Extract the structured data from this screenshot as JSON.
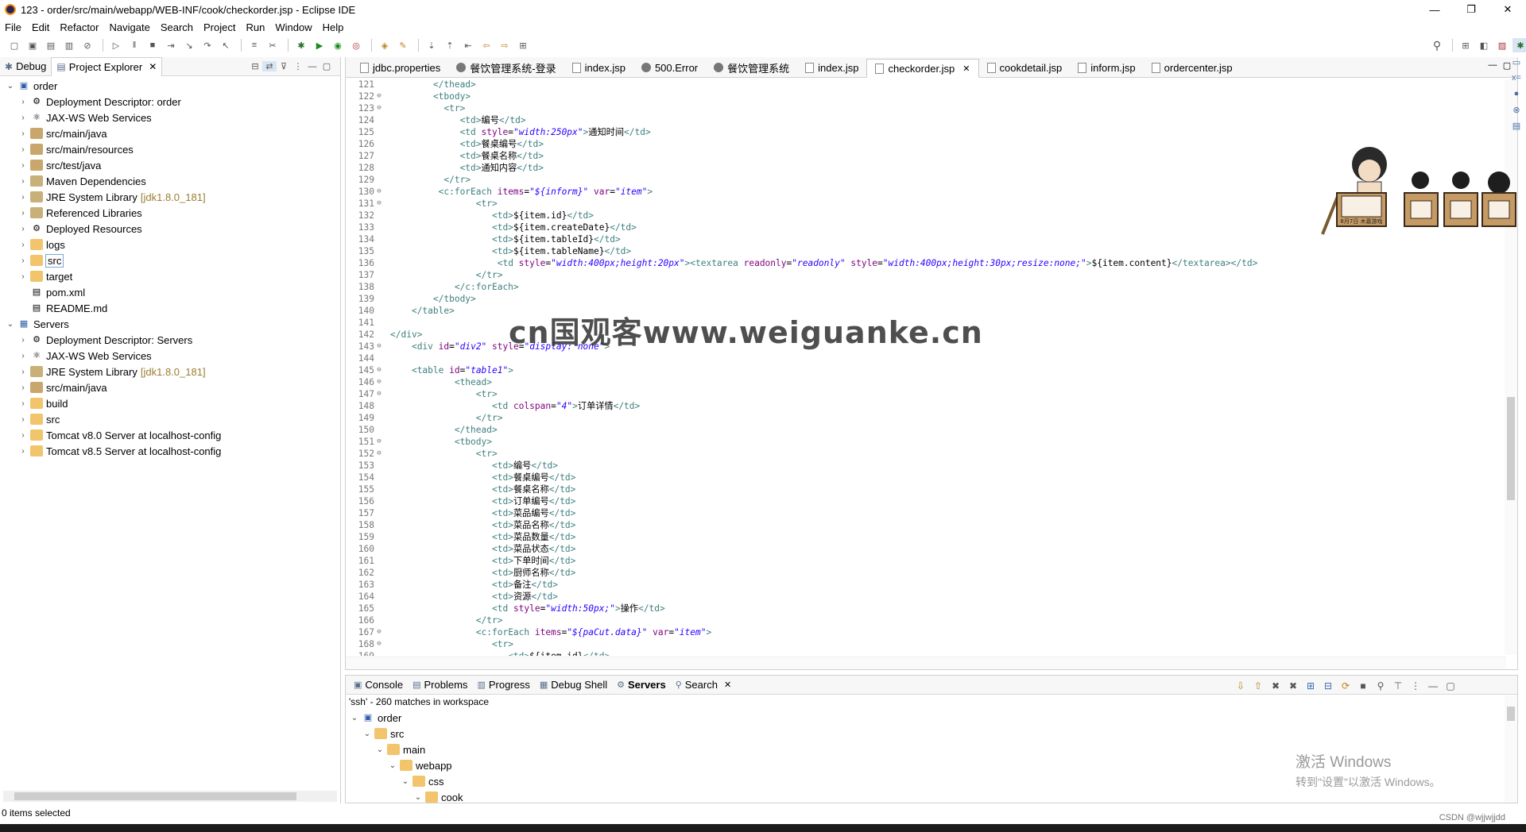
{
  "window": {
    "title": "123 - order/src/main/webapp/WEB-INF/cook/checkorder.jsp - Eclipse IDE",
    "controls": [
      "—",
      "❐",
      "✕"
    ]
  },
  "menu": [
    "File",
    "Edit",
    "Refactor",
    "Navigate",
    "Search",
    "Project",
    "Run",
    "Window",
    "Help"
  ],
  "left_panel": {
    "tabs": [
      {
        "label": "Debug",
        "active": false
      },
      {
        "label": "Project Explorer",
        "active": true
      }
    ],
    "tree": [
      {
        "depth": 0,
        "arrow": "v",
        "icon": "project",
        "label": "order"
      },
      {
        "depth": 1,
        "arrow": ">",
        "icon": "descriptor",
        "label": "Deployment Descriptor: order"
      },
      {
        "depth": 1,
        "arrow": ">",
        "icon": "ws",
        "label": "JAX-WS Web Services"
      },
      {
        "depth": 1,
        "arrow": ">",
        "icon": "pkg",
        "label": "src/main/java"
      },
      {
        "depth": 1,
        "arrow": ">",
        "icon": "pkg",
        "label": "src/main/resources"
      },
      {
        "depth": 1,
        "arrow": ">",
        "icon": "pkg",
        "label": "src/test/java"
      },
      {
        "depth": 1,
        "arrow": ">",
        "icon": "lib",
        "label": "Maven Dependencies"
      },
      {
        "depth": 1,
        "arrow": ">",
        "icon": "lib",
        "label": "JRE System Library",
        "suffix": "[jdk1.8.0_181]"
      },
      {
        "depth": 1,
        "arrow": ">",
        "icon": "lib",
        "label": "Referenced Libraries"
      },
      {
        "depth": 1,
        "arrow": ">",
        "icon": "descriptor",
        "label": "Deployed Resources"
      },
      {
        "depth": 1,
        "arrow": ">",
        "icon": "folder",
        "label": "logs"
      },
      {
        "depth": 1,
        "arrow": ">",
        "icon": "folder",
        "label": "src",
        "selected": true
      },
      {
        "depth": 1,
        "arrow": ">",
        "icon": "folder",
        "label": "target"
      },
      {
        "depth": 1,
        "arrow": "",
        "icon": "file",
        "label": "pom.xml"
      },
      {
        "depth": 1,
        "arrow": "",
        "icon": "file",
        "label": "README.md"
      },
      {
        "depth": 0,
        "arrow": "v",
        "icon": "servers",
        "label": "Servers"
      },
      {
        "depth": 1,
        "arrow": ">",
        "icon": "descriptor",
        "label": "Deployment Descriptor: Servers"
      },
      {
        "depth": 1,
        "arrow": ">",
        "icon": "ws",
        "label": "JAX-WS Web Services"
      },
      {
        "depth": 1,
        "arrow": ">",
        "icon": "lib",
        "label": "JRE System Library",
        "suffix": "[jdk1.8.0_181]"
      },
      {
        "depth": 1,
        "arrow": ">",
        "icon": "pkg",
        "label": "src/main/java"
      },
      {
        "depth": 1,
        "arrow": ">",
        "icon": "folder",
        "label": "build"
      },
      {
        "depth": 1,
        "arrow": ">",
        "icon": "folder",
        "label": "src"
      },
      {
        "depth": 1,
        "arrow": ">",
        "icon": "folder",
        "label": "Tomcat v8.0 Server at localhost-config"
      },
      {
        "depth": 1,
        "arrow": ">",
        "icon": "folder",
        "label": "Tomcat v8.5 Server at localhost-config"
      }
    ]
  },
  "editor": {
    "tabs": [
      {
        "label": "jdbc.properties",
        "icon": "file"
      },
      {
        "label": "餐饮管理系统-登录",
        "icon": "globe"
      },
      {
        "label": "index.jsp",
        "icon": "file"
      },
      {
        "label": "500.Error",
        "icon": "globe"
      },
      {
        "label": "餐饮管理系统",
        "icon": "globe"
      },
      {
        "label": "index.jsp",
        "icon": "file"
      },
      {
        "label": "checkorder.jsp",
        "icon": "file",
        "active": true
      },
      {
        "label": "cookdetail.jsp",
        "icon": "file"
      },
      {
        "label": "inform.jsp",
        "icon": "file"
      },
      {
        "label": "ordercenter.jsp",
        "icon": "file"
      }
    ],
    "lines": [
      {
        "n": "121",
        "fold": "",
        "code": "        </thead>"
      },
      {
        "n": "122",
        "fold": "⊖",
        "code": "        <tbody>"
      },
      {
        "n": "123",
        "fold": "⊖",
        "code": "          <tr>"
      },
      {
        "n": "124",
        "fold": "",
        "code": "             <td>编号</td>"
      },
      {
        "n": "125",
        "fold": "",
        "code": "             <td style=\"width:250px\">通知时间</td>"
      },
      {
        "n": "126",
        "fold": "",
        "code": "             <td>餐桌编号</td>"
      },
      {
        "n": "127",
        "fold": "",
        "code": "             <td>餐桌名称</td>"
      },
      {
        "n": "128",
        "fold": "",
        "code": "             <td>通知内容</td>"
      },
      {
        "n": "129",
        "fold": "",
        "code": "          </tr>"
      },
      {
        "n": "130",
        "fold": "⊖",
        "code": "         <c:forEach items=\"${inform}\" var=\"item\">"
      },
      {
        "n": "131",
        "fold": "⊖",
        "code": "                <tr>"
      },
      {
        "n": "132",
        "fold": "",
        "code": "                   <td>${item.id}</td>"
      },
      {
        "n": "133",
        "fold": "",
        "code": "                   <td>${item.createDate}</td>"
      },
      {
        "n": "134",
        "fold": "",
        "code": "                   <td>${item.tableId}</td>"
      },
      {
        "n": "135",
        "fold": "",
        "code": "                   <td>${item.tableName}</td>"
      },
      {
        "n": "136",
        "fold": "",
        "code": "                    <td style=\"width:400px;height:20px\"><textarea readonly=\"readonly\" style=\"width:400px;height:30px;resize:none;\">${item.content}</textarea></td>"
      },
      {
        "n": "137",
        "fold": "",
        "code": "                </tr>"
      },
      {
        "n": "138",
        "fold": "",
        "code": "            </c:forEach>"
      },
      {
        "n": "139",
        "fold": "",
        "code": "        </tbody>"
      },
      {
        "n": "140",
        "fold": "",
        "code": "    </table>"
      },
      {
        "n": "141",
        "fold": "",
        "code": ""
      },
      {
        "n": "142",
        "fold": "",
        "code": "</div>"
      },
      {
        "n": "143",
        "fold": "⊖",
        "code": "    <div id=\"div2\" style=\"display: none\">"
      },
      {
        "n": "144",
        "fold": "",
        "code": ""
      },
      {
        "n": "145",
        "fold": "⊖",
        "code": "    <table id=\"table1\">"
      },
      {
        "n": "146",
        "fold": "⊖",
        "code": "            <thead>"
      },
      {
        "n": "147",
        "fold": "⊖",
        "code": "                <tr>"
      },
      {
        "n": "148",
        "fold": "",
        "code": "                   <td colspan=\"4\">订单详情</td>"
      },
      {
        "n": "149",
        "fold": "",
        "code": "                </tr>"
      },
      {
        "n": "150",
        "fold": "",
        "code": "            </thead>"
      },
      {
        "n": "151",
        "fold": "⊖",
        "code": "            <tbody>"
      },
      {
        "n": "152",
        "fold": "⊖",
        "code": "                <tr>"
      },
      {
        "n": "153",
        "fold": "",
        "code": "                   <td>编号</td>"
      },
      {
        "n": "154",
        "fold": "",
        "code": "                   <td>餐桌编号</td>"
      },
      {
        "n": "155",
        "fold": "",
        "code": "                   <td>餐桌名称</td>"
      },
      {
        "n": "156",
        "fold": "",
        "code": "                   <td>订单编号</td>"
      },
      {
        "n": "157",
        "fold": "",
        "code": "                   <td>菜品编号</td>"
      },
      {
        "n": "158",
        "fold": "",
        "code": "                   <td>菜品名称</td>"
      },
      {
        "n": "159",
        "fold": "",
        "code": "                   <td>菜品数量</td>"
      },
      {
        "n": "160",
        "fold": "",
        "code": "                   <td>菜品状态</td>"
      },
      {
        "n": "161",
        "fold": "",
        "code": "                   <td>下单时间</td>"
      },
      {
        "n": "162",
        "fold": "",
        "code": "                   <td>厨师名称</td>"
      },
      {
        "n": "163",
        "fold": "",
        "code": "                   <td>备注</td>"
      },
      {
        "n": "164",
        "fold": "",
        "code": "                   <td>资源</td>"
      },
      {
        "n": "165",
        "fold": "",
        "code": "                   <td style=\"width:50px;\">操作</td>"
      },
      {
        "n": "166",
        "fold": "",
        "code": "                </tr>"
      },
      {
        "n": "167",
        "fold": "⊖",
        "code": "                <c:forEach items=\"${paCut.data}\" var=\"item\">"
      },
      {
        "n": "168",
        "fold": "⊖",
        "code": "                   <tr>"
      },
      {
        "n": "169",
        "fold": "",
        "code": "                      <td>${item.id}</td>"
      }
    ],
    "watermark": "cn国观客www.weiguanke.cn",
    "mascot_sign": "8月7日 木嘉游戏"
  },
  "bottom_panel": {
    "tabs": [
      {
        "label": "Console",
        "icon": "▣"
      },
      {
        "label": "Problems",
        "icon": "▤"
      },
      {
        "label": "Progress",
        "icon": "▥"
      },
      {
        "label": "Debug Shell",
        "icon": "▦"
      },
      {
        "label": "Servers",
        "icon": "⚙",
        "bold": true
      },
      {
        "label": "Search",
        "icon": "⚲",
        "active": true
      }
    ],
    "summary": "'ssh' - 260 matches in workspace",
    "results": [
      {
        "depth": 0,
        "arrow": "v",
        "icon": "project",
        "label": "order"
      },
      {
        "depth": 1,
        "arrow": "v",
        "icon": "folder",
        "label": "src"
      },
      {
        "depth": 2,
        "arrow": "v",
        "icon": "folder",
        "label": "main"
      },
      {
        "depth": 3,
        "arrow": "v",
        "icon": "folder",
        "label": "webapp"
      },
      {
        "depth": 4,
        "arrow": "v",
        "icon": "folder",
        "label": "css"
      },
      {
        "depth": 5,
        "arrow": "v",
        "icon": "folder",
        "label": "cook"
      }
    ]
  },
  "activation": {
    "line1": "激活 Windows",
    "line2": "转到\"设置\"以激活 Windows。"
  },
  "status": {
    "text": "0 items selected",
    "credit": "CSDN @wjjwjjdd"
  }
}
